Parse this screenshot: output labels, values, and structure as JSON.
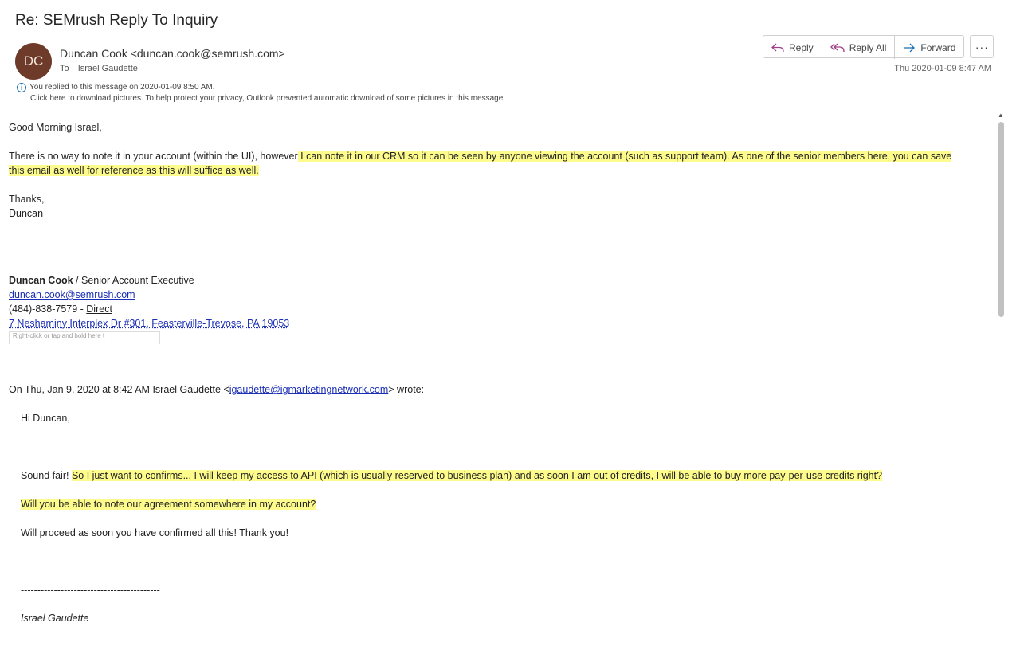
{
  "subject": "Re: SEMrush Reply To Inquiry",
  "sender": {
    "initials": "DC",
    "display": "Duncan Cook <duncan.cook@semrush.com>",
    "to_label": "To",
    "to_name": "Israel Gaudette",
    "avatar_color": "#6e3b2a"
  },
  "actions": {
    "reply": "Reply",
    "reply_all": "Reply All",
    "forward": "Forward",
    "more": "···"
  },
  "date": "Thu 2020-01-09 8:47 AM",
  "info": {
    "line1": "You replied to this message on 2020-01-09 8:50 AM.",
    "line2": "Click here to download pictures. To help protect your privacy, Outlook prevented automatic download of some pictures in this message."
  },
  "body": {
    "greeting": "Good Morning Israel,",
    "para1_plain": "There is no way to note it in your account (within the UI), however",
    "para1_hl_a": " I can note it in our CRM so it can be seen by anyone viewing the account (such as support team). As one of the senior members here, you can save",
    "para1_hl_b": "this email as well for reference as this will suffice as well.",
    "thanks": "Thanks,",
    "name": "Duncan",
    "sig_name": "Duncan Cook",
    "sig_title": " / Senior Account Executive",
    "sig_email": "duncan.cook@semrush.com",
    "sig_phone": "(484)-838-7579 - ",
    "sig_direct": "Direct",
    "sig_address": "7 Neshaminy Interplex Dr #301, Feasterville-Trevose, PA 19053",
    "broken_image": "Right-click or tap and hold here t"
  },
  "quoted": {
    "header_pre": "On Thu, Jan 9, 2020 at 8:42 AM Israel Gaudette <",
    "header_email": "igaudette@igmarketingnetwork.com",
    "header_post": "> wrote:",
    "greeting": "Hi Duncan,",
    "line1_plain": "Sound fair! ",
    "line1_hl": "So I just want to confirms... I will keep my access to API (which is usually reserved to business plan) and as soon I am out of credits, I will be able to buy more pay-per-use credits right? ",
    "line2_hl": "Will you be able to note our agreement somewhere in my account? ",
    "line3": "Will proceed as soon you have confirmed all this! Thank you!",
    "divider": "------------------------------------------",
    "signature": "Israel Gaudette"
  }
}
